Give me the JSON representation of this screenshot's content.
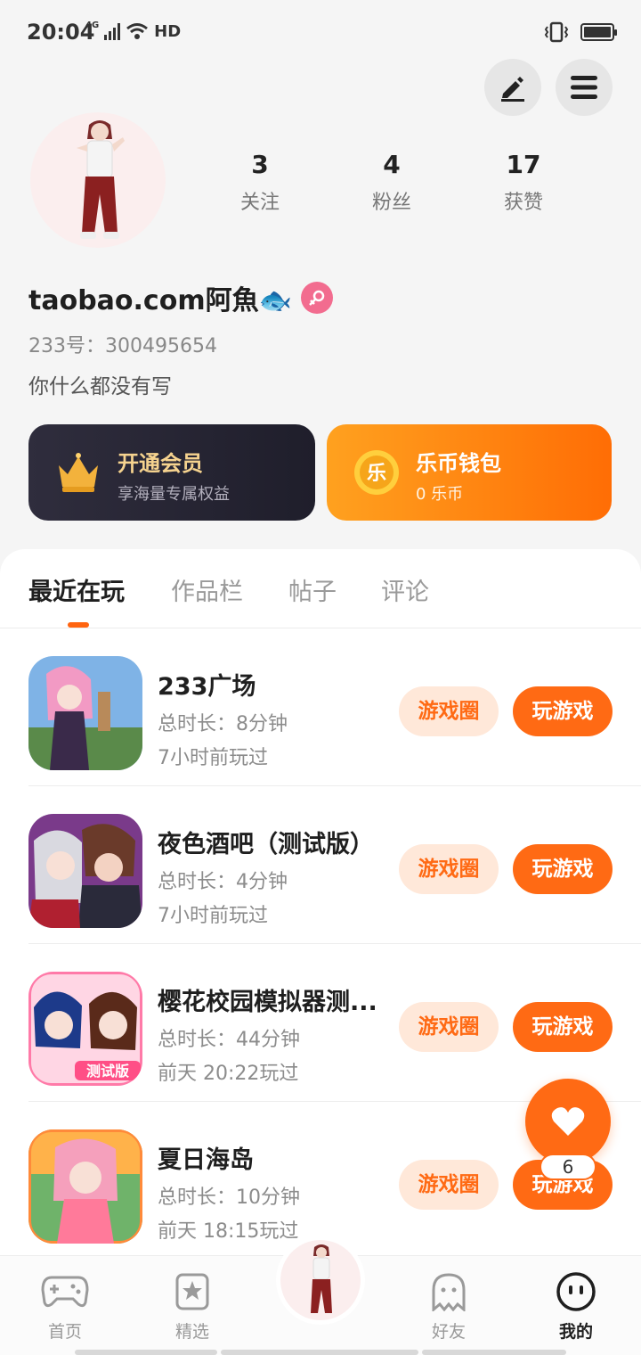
{
  "status_bar": {
    "time": "20:04",
    "network": "4G",
    "hd": "HD"
  },
  "profile": {
    "stats": [
      {
        "num": "3",
        "label": "关注"
      },
      {
        "num": "4",
        "label": "粉丝"
      },
      {
        "num": "17",
        "label": "获赞"
      }
    ],
    "username": "taobao.com阿魚🐟",
    "user_id": "233号：300495654",
    "bio": "你什么都没有写"
  },
  "cards": {
    "vip": {
      "title": "开通会员",
      "subtitle": "享海量专属权益"
    },
    "wallet": {
      "title": "乐币钱包",
      "subtitle": "0 乐币",
      "icon_char": "乐"
    }
  },
  "tabs": [
    "最近在玩",
    "作品栏",
    "帖子",
    "评论"
  ],
  "games": [
    {
      "title": "233广场",
      "duration": "总时长：8分钟",
      "last_played": "7小时前玩过",
      "circle_label": "游戏圈",
      "play_label": "玩游戏"
    },
    {
      "title": "夜色酒吧（测试版）",
      "duration": "总时长：4分钟",
      "last_played": "7小时前玩过",
      "circle_label": "游戏圈",
      "play_label": "玩游戏"
    },
    {
      "title": "樱花校园模拟器测...",
      "duration": "总时长：44分钟",
      "last_played": "前天 20:22玩过",
      "circle_label": "游戏圈",
      "play_label": "玩游戏",
      "thumb_tag": "测试版"
    },
    {
      "title": "夏日海岛",
      "duration": "总时长：10分钟",
      "last_played": "前天 18:15玩过",
      "circle_label": "游戏圈",
      "play_label": "玩游戏"
    }
  ],
  "fab": {
    "count": "6"
  },
  "bottom_nav": [
    {
      "label": "首页",
      "icon": "gamepad-icon"
    },
    {
      "label": "精选",
      "icon": "star-bookmark-icon"
    },
    {
      "label": "好友",
      "icon": "ghost-icon"
    },
    {
      "label": "我的",
      "icon": "face-icon"
    }
  ],
  "colors": {
    "accent": "#ff6a14",
    "accent_light": "#ffe8d9",
    "vip_gold": "#f6d38f"
  }
}
